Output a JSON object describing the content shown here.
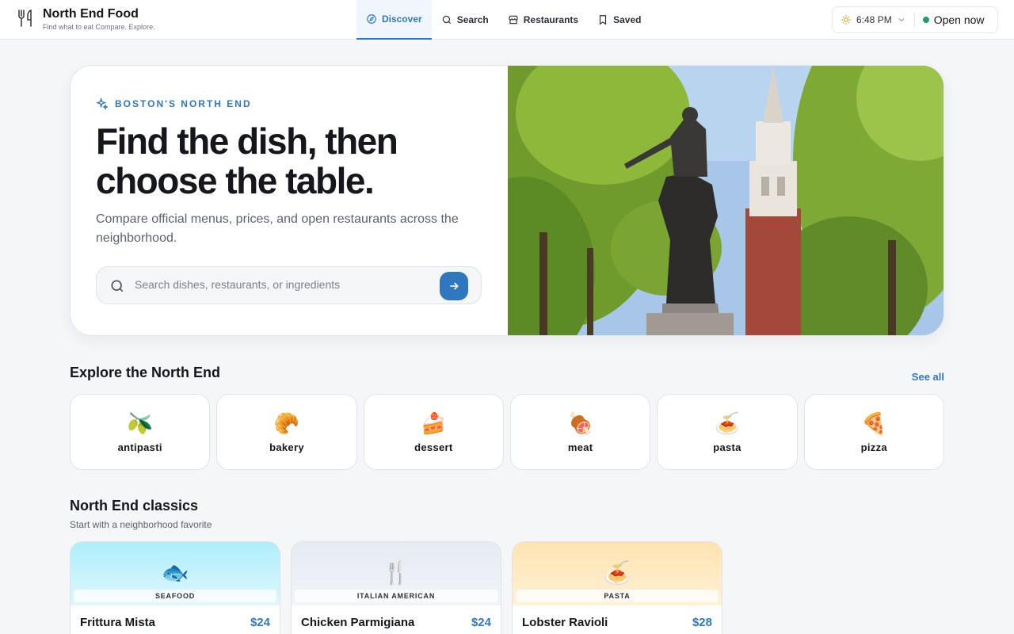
{
  "brand": {
    "name": "North End Food",
    "tagline": "Find what to eat Compare. Explore.",
    "icon": "fork-knife-icon"
  },
  "nav": {
    "tabs": [
      {
        "label": "Discover",
        "icon": "compass-icon",
        "active": true
      },
      {
        "label": "Search",
        "icon": "search-icon",
        "active": false
      },
      {
        "label": "Restaurants",
        "icon": "storefront-icon",
        "active": false
      },
      {
        "label": "Saved",
        "icon": "bookmark-icon",
        "active": false
      }
    ]
  },
  "status": {
    "time": "6:48 PM",
    "open_label": "Open now",
    "open_color": "#1f9d6b"
  },
  "hero": {
    "eyebrow": "BOSTON'S NORTH END",
    "headline": "Find the dish, then choose the table.",
    "subtitle": "Compare official menus, prices, and open restaurants across the neighborhood.",
    "search_placeholder": "Search dishes, restaurants, or ingredients"
  },
  "explore": {
    "title": "Explore the North End",
    "see_all": "See all",
    "categories": [
      {
        "emoji": "🫒",
        "label": "antipasti"
      },
      {
        "emoji": "🥐",
        "label": "bakery"
      },
      {
        "emoji": "🍰",
        "label": "dessert"
      },
      {
        "emoji": "🍖",
        "label": "meat"
      },
      {
        "emoji": "🍝",
        "label": "pasta"
      },
      {
        "emoji": "🍕",
        "label": "pizza"
      }
    ]
  },
  "classics": {
    "title": "North End classics",
    "subtitle": "Start with a neighborhood favorite",
    "cards": [
      {
        "emoji": "🐟",
        "tag": "SEAFOOD",
        "name": "Frittura Mista",
        "price": "$24"
      },
      {
        "emoji": "🍴",
        "tag": "ITALIAN AMERICAN",
        "name": "Chicken Parmigiana",
        "price": "$24"
      },
      {
        "emoji": "🍝",
        "tag": "PASTA",
        "name": "Lobster Ravioli",
        "price": "$28"
      }
    ]
  },
  "colors": {
    "accent": "#2f78bf",
    "text": "#15171c",
    "background": "#f5f6f8"
  }
}
